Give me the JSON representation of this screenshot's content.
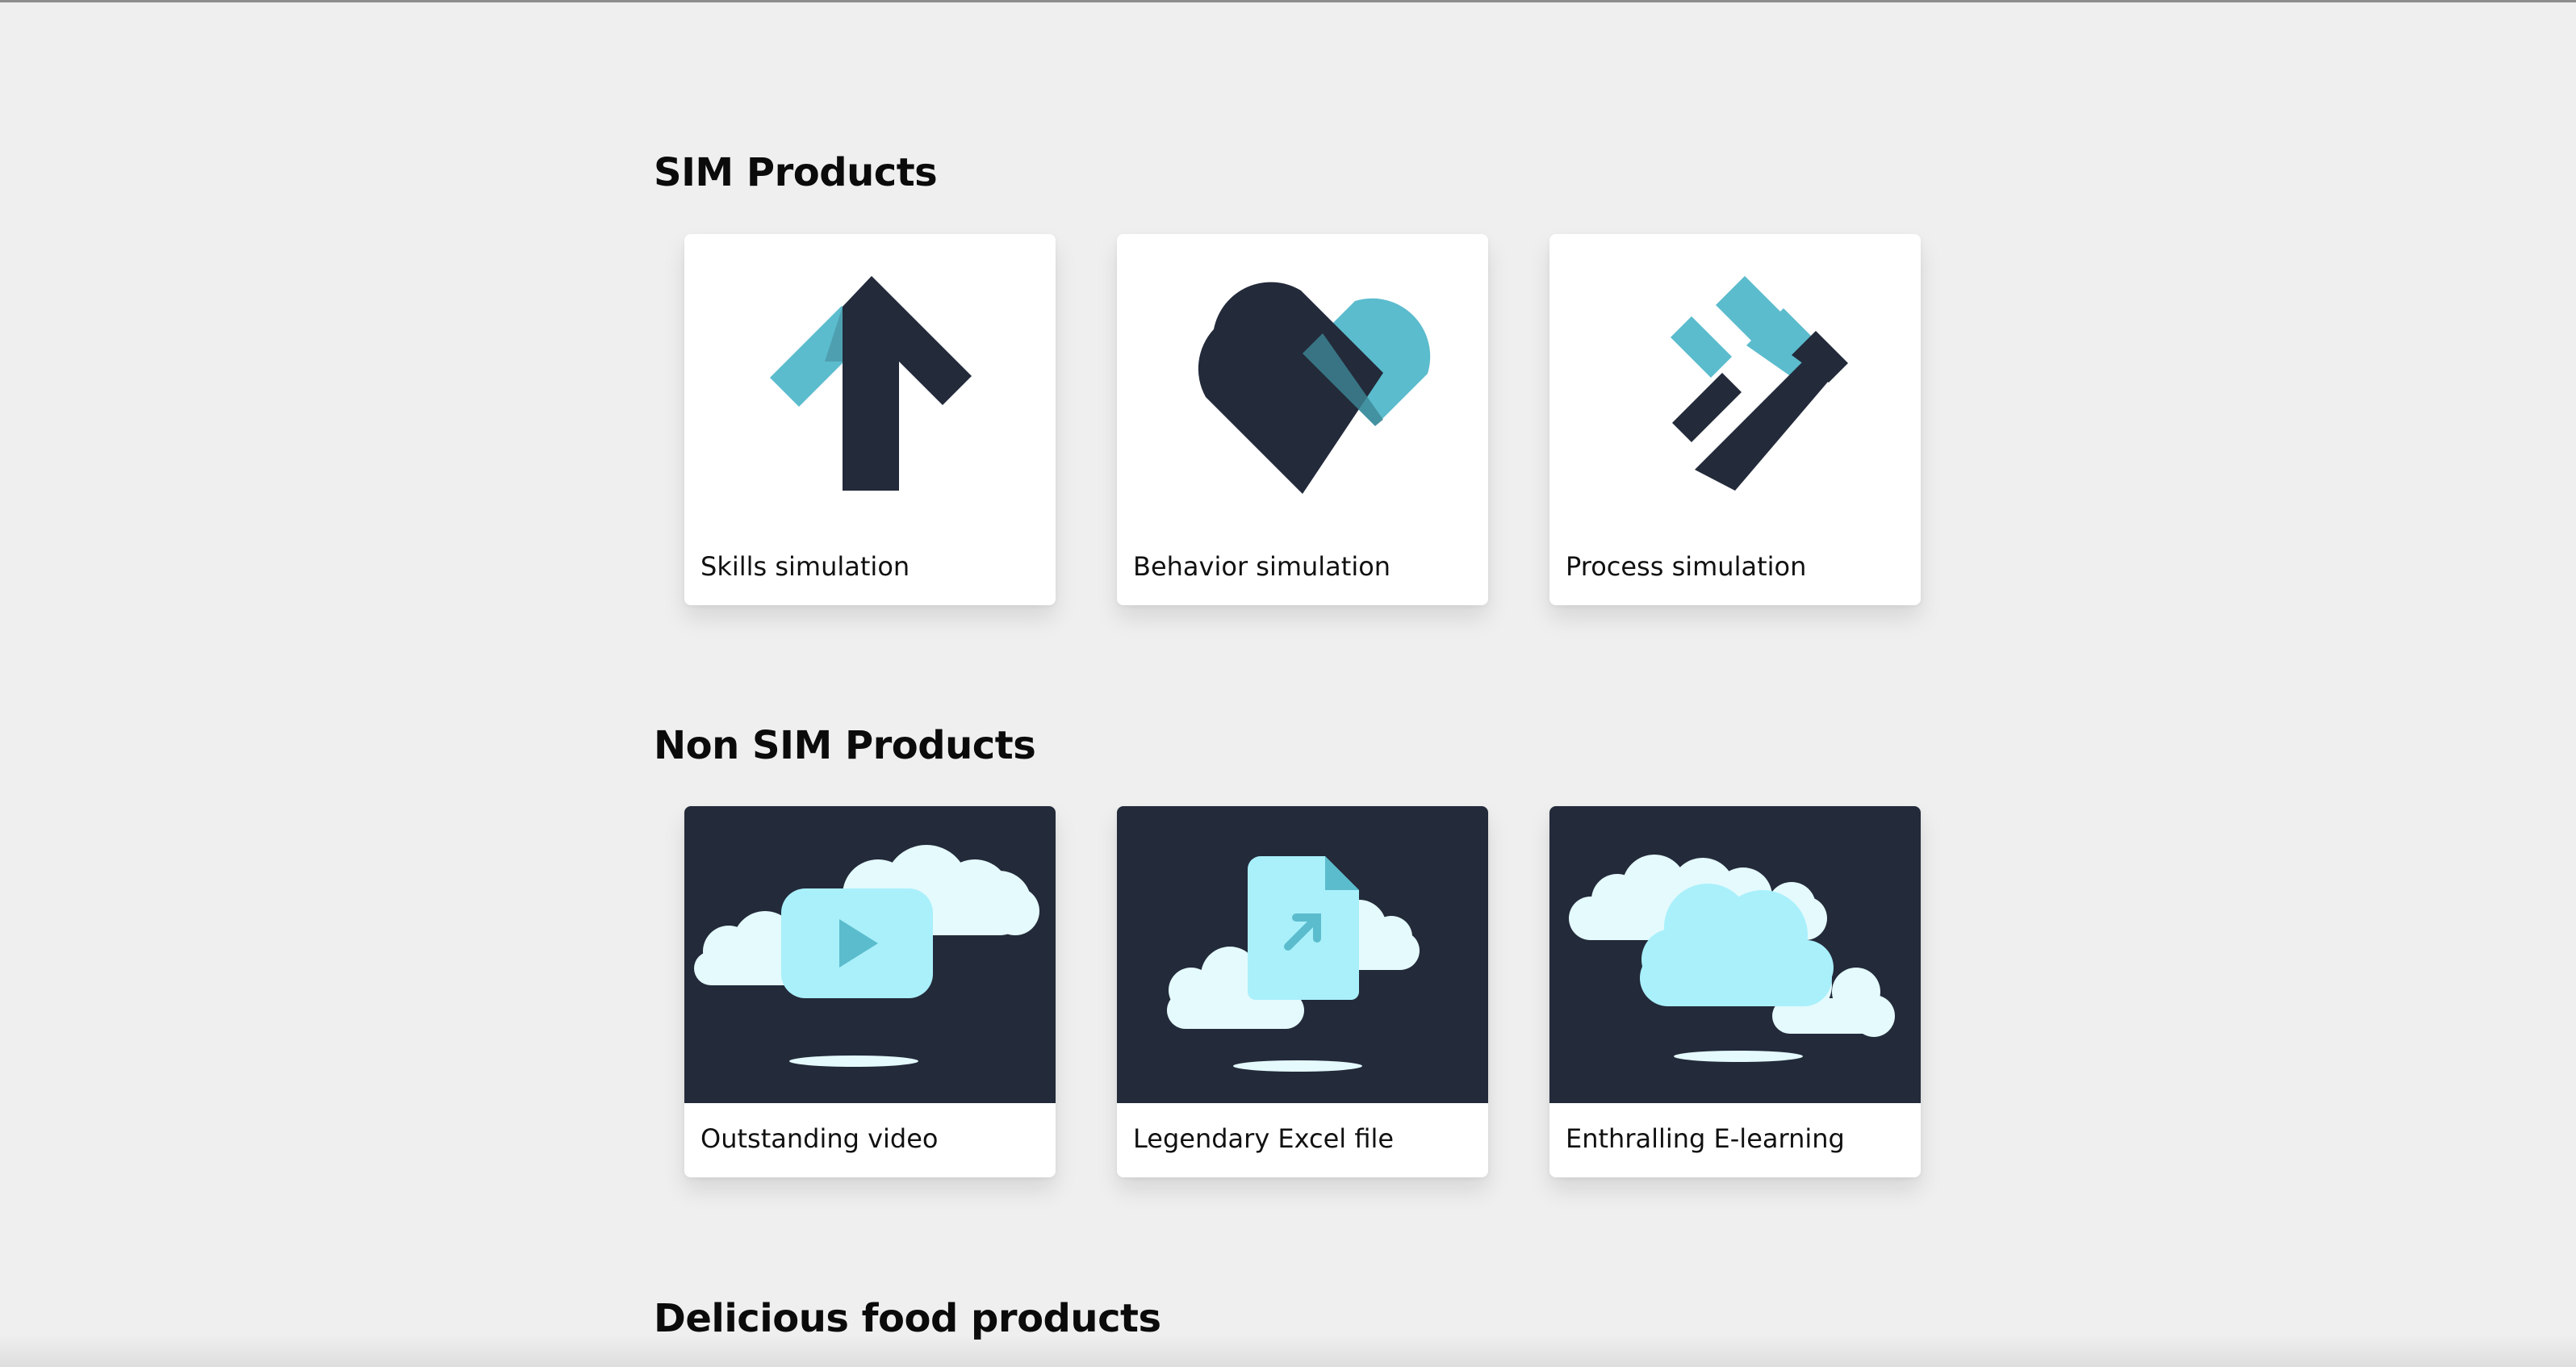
{
  "sections": [
    {
      "title": "SIM Products",
      "cards": [
        {
          "label": "Skills simulation",
          "icon": "arrow-up-icon"
        },
        {
          "label": "Behavior simulation",
          "icon": "heart-icon"
        },
        {
          "label": "Process simulation",
          "icon": "process-blocks-icon"
        }
      ]
    },
    {
      "title": "Non SIM Products",
      "cards": [
        {
          "label": "Outstanding video",
          "icon": "video-cloud-icon"
        },
        {
          "label": "Legendary Excel file",
          "icon": "file-cloud-icon"
        },
        {
          "label": "Enthralling E-learning",
          "icon": "cloud-icon"
        }
      ]
    },
    {
      "title": "Delicious food products",
      "cards": []
    }
  ],
  "colors": {
    "page_background": "#efefef",
    "navy": "#232a3a",
    "teal": "#5bbccd",
    "light_cyan": "#a9f0fb",
    "cloud_white": "#e4fafd"
  }
}
